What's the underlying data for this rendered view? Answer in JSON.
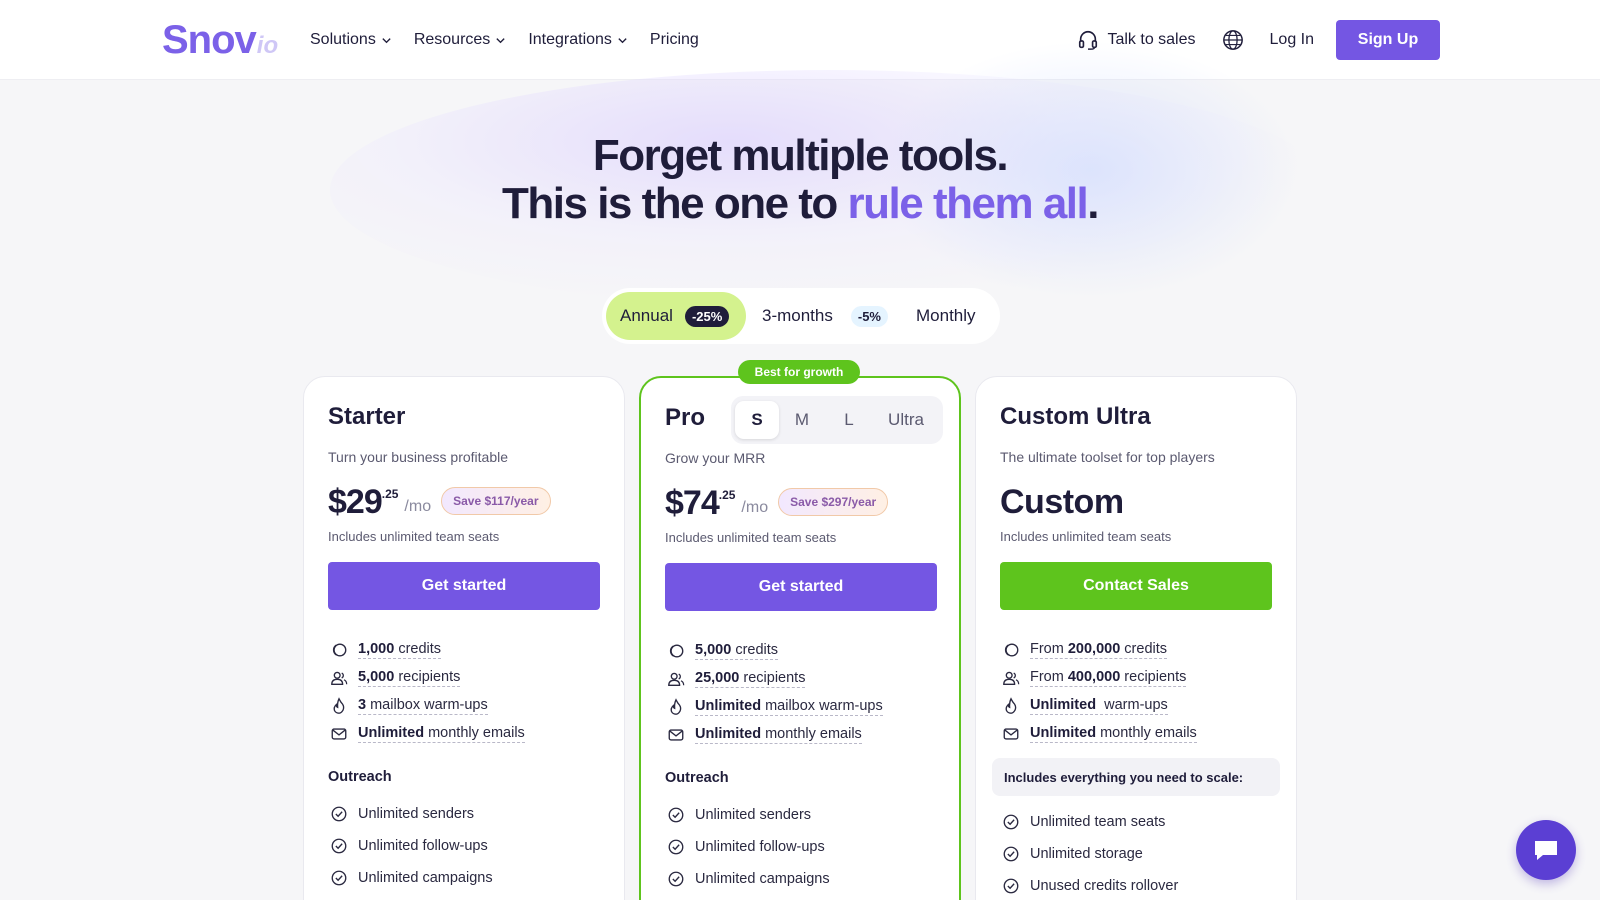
{
  "header": {
    "logo": {
      "main": "Snov",
      "sub": "io"
    },
    "nav": [
      {
        "label": "Solutions",
        "dropdown": true
      },
      {
        "label": "Resources",
        "dropdown": true
      },
      {
        "label": "Integrations",
        "dropdown": true
      },
      {
        "label": "Pricing",
        "dropdown": false
      }
    ],
    "talk_to_sales": "Talk to sales",
    "login": "Log In",
    "signup": "Sign Up"
  },
  "hero": {
    "line1": "Forget multiple tools.",
    "line2_prefix": "This is the one to ",
    "line2_accent": "rule them all",
    "line2_suffix": "."
  },
  "billing": {
    "annual": {
      "label": "Annual",
      "badge": "-25%",
      "selected": true
    },
    "three_months": {
      "label": "3-months",
      "badge": "-5%"
    },
    "monthly": {
      "label": "Monthly"
    }
  },
  "plans": {
    "starter": {
      "name": "Starter",
      "subtitle": "Turn your business profitable",
      "price": "$29",
      "cents": ".25",
      "per": "/mo",
      "save": "Save $117/year",
      "seats": "Includes unlimited team seats",
      "cta": "Get started",
      "features": [
        {
          "bold": "1,000",
          "text": " credits",
          "icon": "credits-icon"
        },
        {
          "bold": "5,000",
          "text": " recipients",
          "icon": "recipients-icon"
        },
        {
          "bold": "3",
          "text": " mailbox warm-ups",
          "icon": "flame-icon"
        },
        {
          "bold": "Unlimited",
          "text": " monthly emails",
          "icon": "mail-icon"
        }
      ],
      "section": "Outreach",
      "checks": [
        "Unlimited senders",
        "Unlimited follow-ups",
        "Unlimited campaigns"
      ]
    },
    "pro": {
      "badge": "Best for growth",
      "name": "Pro",
      "sizes": [
        "S",
        "M",
        "L",
        "Ultra"
      ],
      "selected_size": "S",
      "subtitle": "Grow your MRR",
      "price": "$74",
      "cents": ".25",
      "per": "/mo",
      "save": "Save $297/year",
      "seats": "Includes unlimited team seats",
      "cta": "Get started",
      "features": [
        {
          "bold": "5,000",
          "text": " credits",
          "icon": "credits-icon"
        },
        {
          "bold": "25,000",
          "text": " recipients",
          "icon": "recipients-icon"
        },
        {
          "bold": "Unlimited",
          "text": " mailbox warm-ups",
          "icon": "flame-icon"
        },
        {
          "bold": "Unlimited",
          "text": " monthly emails",
          "icon": "mail-icon"
        }
      ],
      "section": "Outreach",
      "checks": [
        "Unlimited senders",
        "Unlimited follow-ups",
        "Unlimited campaigns"
      ]
    },
    "ultra": {
      "name": "Custom Ultra",
      "subtitle": "The ultimate toolset for top players",
      "price": "Custom",
      "seats": "Includes unlimited team seats",
      "cta": "Contact Sales",
      "features": [
        {
          "pre": "From ",
          "bold": "200,000",
          "text": " credits",
          "icon": "credits-icon"
        },
        {
          "pre": "From ",
          "bold": "400,000",
          "text": " recipients",
          "icon": "recipients-icon"
        },
        {
          "pre": "",
          "bold": "Unlimited",
          "text": "  warm-ups",
          "icon": "flame-icon"
        },
        {
          "pre": "",
          "bold": "Unlimited",
          "text": " monthly emails",
          "icon": "mail-icon"
        }
      ],
      "scale_note": "Includes everything you need to scale:",
      "checks": [
        "Unlimited team seats",
        "Unlimited storage",
        "Unused credits rollover"
      ]
    }
  },
  "colors": {
    "brand": "#7456e3",
    "accent_green": "#5ec41d",
    "toggle_selected": "#d4f28e",
    "text_dark": "#1f1d3a"
  }
}
